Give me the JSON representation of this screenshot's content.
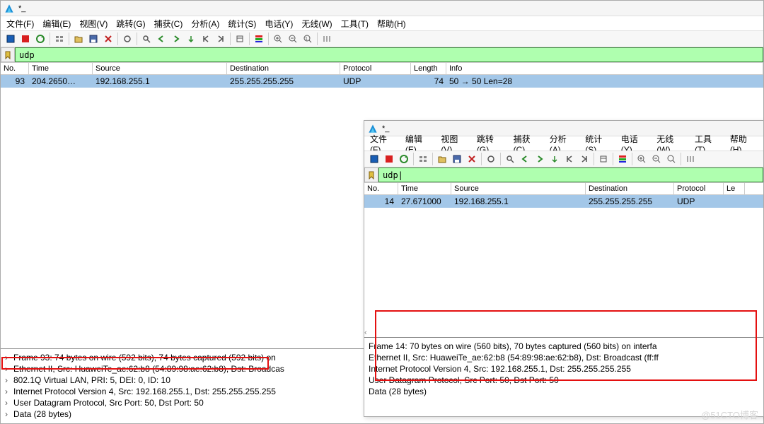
{
  "title": "*_",
  "menu": {
    "file": "文件(F)",
    "edit": "编辑(E)",
    "view": "视图(V)",
    "goto": "跳转(G)",
    "capture": "捕获(C)",
    "analyze": "分析(A)",
    "stats": "统计(S)",
    "telephony": "电话(Y)",
    "wireless": "无线(W)",
    "tools": "工具(T)",
    "help": "帮助(H)"
  },
  "filter": "udp",
  "filter2": "udp|",
  "cols": {
    "no": "No.",
    "time": "Time",
    "src": "Source",
    "dst": "Destination",
    "proto": "Protocol",
    "len": "Length",
    "info": "Info",
    "len2": "Le"
  },
  "win1_row": {
    "no": "93",
    "time": "204.2650…",
    "src": "192.168.255.1",
    "dst": "255.255.255.255",
    "proto": "UDP",
    "len": "74",
    "info": "50 → 50 Len=28"
  },
  "win2_row": {
    "no": "14",
    "time": "27.671000",
    "src": "192.168.255.1",
    "dst": "255.255.255.255",
    "proto": "UDP",
    "len": "",
    "info": ""
  },
  "win1_details": {
    "l1": "Frame 93: 74 bytes on wire (592 bits), 74 bytes captured (592 bits) on",
    "l2": "Ethernet II, Src: HuaweiTe_ae:62:b8 (54:89:98:ae:62:b8), Dst: Broadcas",
    "l3": "802.1Q Virtual LAN, PRI: 5, DEI: 0, ID: 10",
    "l4": "Internet Protocol Version 4, Src: 192.168.255.1, Dst: 255.255.255.255",
    "l5": "User Datagram Protocol, Src Port: 50, Dst Port: 50",
    "l6": "Data (28 bytes)"
  },
  "win2_details": {
    "l1": "Frame 14: 70 bytes on wire (560 bits), 70 bytes captured (560 bits) on interfa",
    "l2": "Ethernet II, Src: HuaweiTe_ae:62:b8 (54:89:98:ae:62:b8), Dst: Broadcast (ff:ff",
    "l3": "Internet Protocol Version 4, Src: 192.168.255.1, Dst: 255.255.255.255",
    "l4": "User Datagram Protocol, Src Port: 50, Dst Port: 50",
    "l5": "Data (28 bytes)"
  },
  "watermark": "@51CTO博客"
}
